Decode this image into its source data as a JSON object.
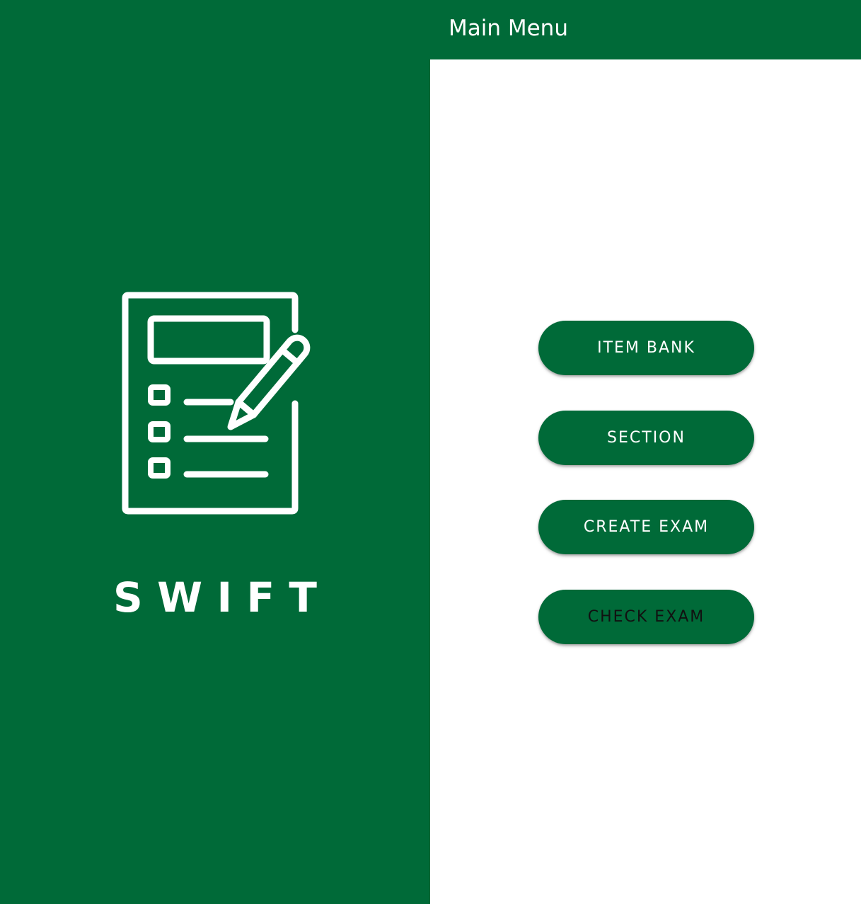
{
  "app": {
    "logo_text": "SWIFT",
    "logo_icon": "exam-sheet-with-pencil-icon"
  },
  "app_bar": {
    "title": "Main Menu"
  },
  "menu": {
    "items": [
      {
        "label": "ITEM BANK",
        "text_color": "#ffffff"
      },
      {
        "label": "SECTION",
        "text_color": "#ffffff"
      },
      {
        "label": "CREATE EXAM",
        "text_color": "#ffffff"
      },
      {
        "label": "CHECK EXAM",
        "text_color": "#111111"
      }
    ]
  },
  "colors": {
    "brand_green": "#006a38",
    "background": "#ffffff",
    "icon_white": "#ffffff"
  }
}
